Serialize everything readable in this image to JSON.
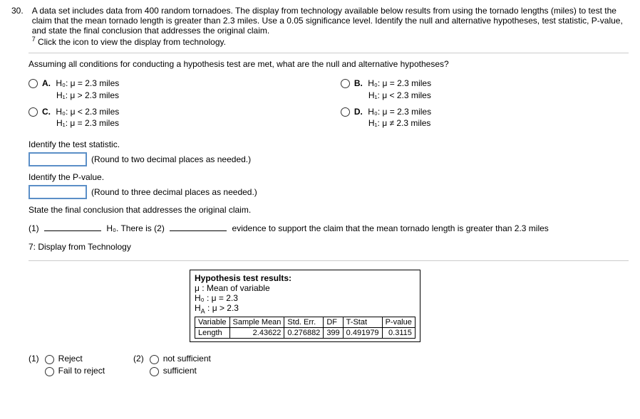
{
  "question": {
    "number": "30.",
    "text": "A data set includes data from 400 random tornadoes. The display from technology available below results from using the tornado lengths (miles) to test the claim that the mean tornado length is greater than 2.3 miles. Use a 0.05 significance level. Identify the null and alternative hypotheses, test statistic, P-value, and state the final conclusion that addresses the original claim.",
    "ref_marker": "7",
    "ref_text": "Click the icon to view the display from technology."
  },
  "prompt1": "Assuming all conditions for conducting a hypothesis test are met, what are the null and alternative hypotheses?",
  "options": {
    "A": {
      "label": "A.",
      "line1": "H₀: μ = 2.3 miles",
      "line2": "H₁: μ > 2.3 miles"
    },
    "B": {
      "label": "B.",
      "line1": "H₀: μ = 2.3 miles",
      "line2": "H₁: μ < 2.3 miles"
    },
    "C": {
      "label": "C.",
      "line1": "H₀: μ < 2.3 miles",
      "line2": "H₁: μ = 2.3 miles"
    },
    "D": {
      "label": "D.",
      "line1": "H₀: μ = 2.3 miles",
      "line2": "H₁: μ ≠ 2.3 miles"
    }
  },
  "identify_test": "Identify the test statistic.",
  "round_test": "(Round to two decimal places as needed.)",
  "identify_pvalue": "Identify the P-value.",
  "round_pvalue": "(Round to three decimal places as needed.)",
  "state_conclusion": "State the final conclusion that addresses the original claim.",
  "conclusion": {
    "part1_label": "(1)",
    "mid_text": "H₀. There is",
    "part2_label": "(2)",
    "end_text": "evidence to support the claim that the mean tornado length is greater than 2.3 miles"
  },
  "tech_heading": "7: Display from Technology",
  "tech_box": {
    "title": "Hypothesis test results:",
    "line1": "μ : Mean of variable",
    "line2": "H₀ : μ = 2.3",
    "line3": "H",
    "line3_sub": "A",
    "line3_rest": " : μ > 2.3",
    "headers": [
      "Variable",
      "Sample Mean",
      "Std. Err.",
      "DF",
      "T-Stat",
      "P-value"
    ],
    "row": [
      "Length",
      "2.43622",
      "0.276882",
      "399",
      "0.491979",
      "0.3115"
    ]
  },
  "bottom": {
    "g1_label": "(1)",
    "g1_opts": [
      "Reject",
      "Fail to reject"
    ],
    "g2_label": "(2)",
    "g2_opts": [
      "not sufficient",
      "sufficient"
    ]
  }
}
